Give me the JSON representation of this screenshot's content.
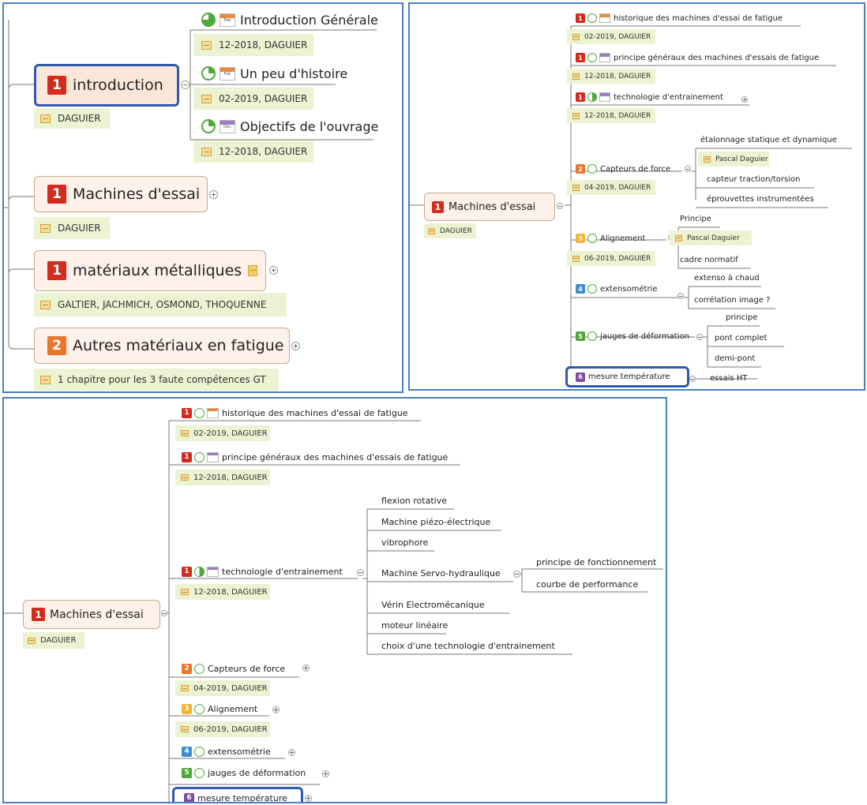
{
  "p1": {
    "main": [
      {
        "label": "introduction",
        "badge": "1",
        "note": "DAGUIER"
      },
      {
        "label": "Machines d'essai",
        "badge": "1",
        "note": "DAGUIER"
      },
      {
        "label": "matériaux métalliques",
        "badge": "1",
        "note": "GALTIER, JACHMICH, OSMOND, THOQUENNE"
      },
      {
        "label": "Autres matériaux en fatigue",
        "badge": "2",
        "note": "1 chapitre pour les 3 faute compétences GT"
      }
    ],
    "children": [
      {
        "label": "Introduction Générale",
        "cal": "Feb",
        "note": "12-2018, DAGUIER"
      },
      {
        "label": "Un peu d'histoire",
        "cal": "Feb",
        "note": "02-2019, DAGUIER"
      },
      {
        "label": "Objectifs de l'ouvrage",
        "cal": "Dec",
        "note": "12-2018, DAGUIER"
      }
    ]
  },
  "p2": {
    "main": {
      "label": "Machines d'essai",
      "badge": "1",
      "note": "DAGUIER"
    },
    "items": [
      {
        "label": "historique des machines d'essai de fatigue",
        "badge": "1",
        "cal": "Feb",
        "note": "02-2019, DAGUIER"
      },
      {
        "label": "principe généraux des machines d'essais de fatigue",
        "badge": "1",
        "cal": "Dec",
        "note": "12-2018, DAGUIER"
      },
      {
        "label": "technologie d'entrainement",
        "badge": "1",
        "cal": "Dec",
        "note": "12-2018, DAGUIER"
      },
      {
        "label": "Capteurs de force",
        "badge": "2",
        "note": "04-2019, DAGUIER"
      },
      {
        "label": "Alignement",
        "badge": "3",
        "note": "06-2019, DAGUIER"
      },
      {
        "label": "extensométrie",
        "badge": "4"
      },
      {
        "label": "jauges de déformation",
        "badge": "5"
      },
      {
        "label": "mesure température",
        "badge": "6"
      }
    ],
    "capteurs": {
      "c1": "étalonnage statique et dynamique",
      "c1note": "Pascal Daguier",
      "c2": "capteur traction/torsion",
      "c3": "éprouvettes instrumentées"
    },
    "alignement": {
      "c1": "Principe",
      "c1note": "Pascal Daguier",
      "c2": "cadre normatif"
    },
    "extenso": {
      "c1": "extenso à chaud",
      "c2": "corrélation image ?"
    },
    "jauges": {
      "c1": "principe",
      "c2": "pont complet",
      "c3": "demi-pont"
    },
    "mesure": {
      "c1": "essais HT"
    }
  },
  "p3": {
    "main": {
      "label": "Machines d'essai",
      "badge": "1",
      "note": "DAGUIER"
    },
    "items": [
      {
        "label": "historique des machines d'essai de fatigue",
        "badge": "1",
        "cal": "Feb",
        "note": "02-2019, DAGUIER"
      },
      {
        "label": "principe généraux des machines d'essais de fatigue",
        "badge": "1",
        "cal": "Dec",
        "note": "12-2018, DAGUIER"
      },
      {
        "label": "technologie d'entrainement",
        "badge": "1",
        "cal": "Dec",
        "note": "12-2018, DAGUIER"
      },
      {
        "label": "Capteurs de force",
        "badge": "2",
        "note": "04-2019, DAGUIER"
      },
      {
        "label": "Alignement",
        "badge": "3",
        "note": "06-2019, DAGUIER"
      },
      {
        "label": "extensométrie",
        "badge": "4"
      },
      {
        "label": "jauges de déformation",
        "badge": "5"
      },
      {
        "label": "mesure température",
        "badge": "6"
      }
    ],
    "techno": [
      "flexion rotative",
      "Machine piézo-électrique",
      "vibrophore",
      "Machine Servo-hydraulique",
      "Vérin Electromécanique",
      "moteur linéaire",
      "choix d'une technologie d'entrainement"
    ],
    "servo": [
      "principe de fonctionnement",
      "courbe de performance"
    ]
  }
}
